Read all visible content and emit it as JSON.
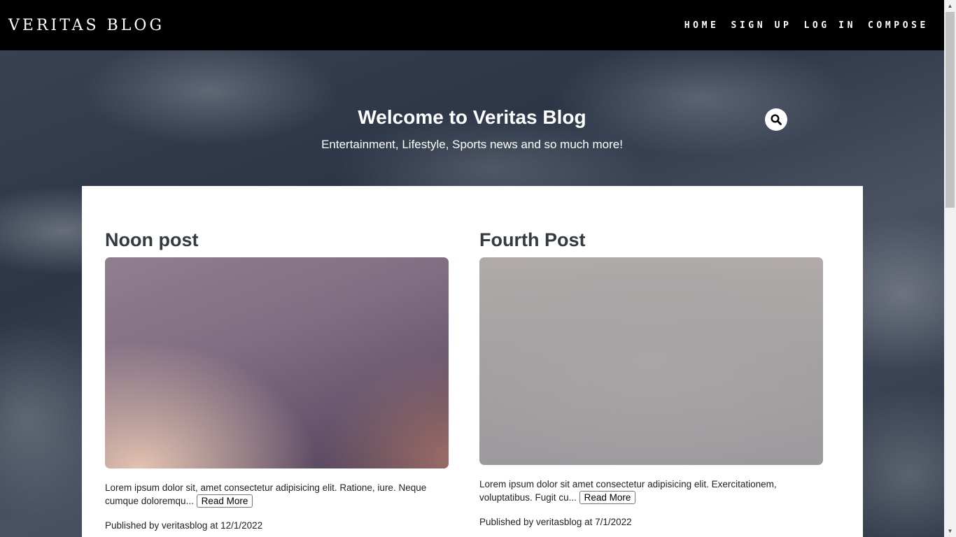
{
  "navbar": {
    "brand": "VERITAS BLOG",
    "links": [
      "HOME",
      "SIGN UP",
      "LOG IN",
      "COMPOSE"
    ]
  },
  "hero": {
    "title": "Welcome to Veritas Blog",
    "subtitle": "Entertainment, Lifestyle, Sports news and so much more!"
  },
  "icons": {
    "search": "search-icon"
  },
  "posts": [
    {
      "title": "Noon post",
      "excerpt": "Lorem ipsum dolor sit, amet consectetur adipisicing elit. Ratione, iure. Neque cumque doloremqu...",
      "read_more": "Read More",
      "meta": "Published by veritasblog at 12/1/2022"
    },
    {
      "title": "Fourth Post",
      "excerpt": "Lorem ipsum dolor sit amet consectetur adipisicing elit. Exercitationem, voluptatibus. Fugit cu...",
      "read_more": "Read More",
      "meta": "Published by veritasblog at 7/1/2022"
    }
  ],
  "colors": {
    "navbar_bg": "#000000",
    "content_bg": "#ffffff",
    "title_text": "#333a40"
  }
}
